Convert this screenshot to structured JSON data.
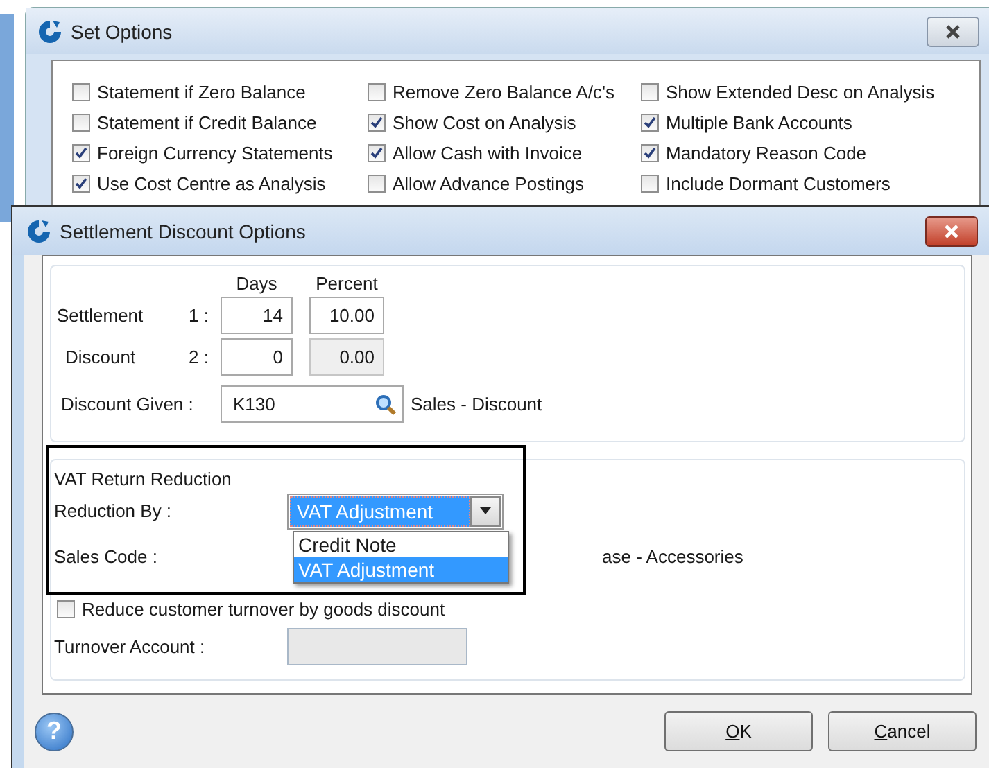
{
  "background_window": {
    "title": "Set Options",
    "options": [
      {
        "label": "Statement if Zero Balance",
        "checked": false
      },
      {
        "label": "Remove Zero Balance  A/c's",
        "checked": false
      },
      {
        "label": "Show Extended Desc on Analysis",
        "checked": false
      },
      {
        "label": "Statement if Credit Balance",
        "checked": false
      },
      {
        "label": "Show Cost on Analysis",
        "checked": true
      },
      {
        "label": "Multiple Bank Accounts",
        "checked": true
      },
      {
        "label": "Foreign Currency Statements",
        "checked": true
      },
      {
        "label": "Allow Cash with Invoice",
        "checked": true
      },
      {
        "label": "Mandatory Reason Code",
        "checked": true
      },
      {
        "label": "Use Cost Centre as Analysis",
        "checked": true
      },
      {
        "label": "Allow Advance Postings",
        "checked": false
      },
      {
        "label": "Include Dormant Customers",
        "checked": false
      }
    ]
  },
  "dialog": {
    "title": "Settlement Discount Options",
    "settlement": {
      "days_header": "Days",
      "percent_header": "Percent",
      "rows": [
        {
          "label": "Settlement",
          "index": "1 :",
          "days": "14",
          "percent": "10.00",
          "percent_disabled": false
        },
        {
          "label": "Discount",
          "index": "2 :",
          "days": "0",
          "percent": "0.00",
          "percent_disabled": true
        }
      ]
    },
    "discount_given": {
      "label": "Discount Given :",
      "value": "K130",
      "description": "Sales - Discount"
    },
    "vat": {
      "legend": "VAT Return Reduction",
      "reduction_label": "Reduction By :",
      "reduction_value": "VAT Adjustment",
      "options": [
        {
          "label": "Credit Note",
          "selected": false
        },
        {
          "label": "VAT Adjustment",
          "selected": true
        }
      ],
      "sales_code_label": "Sales Code :",
      "sales_code_description": "ase - Accessories"
    },
    "reduce_turnover": {
      "label": "Reduce customer turnover by goods discount",
      "checked": false
    },
    "turnover_account": {
      "label": "Turnover Account :",
      "disabled": true
    },
    "help": "?",
    "buttons": [
      "OK",
      "Cancel"
    ]
  }
}
